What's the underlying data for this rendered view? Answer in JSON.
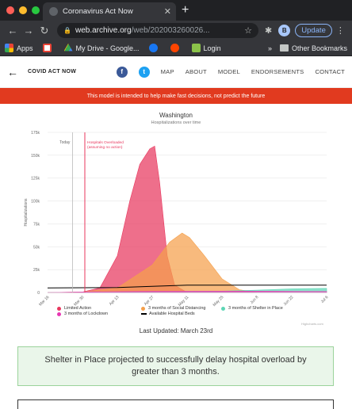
{
  "browser": {
    "tab_title": "Coronavirus Act Now",
    "url_host": "web.archive.org",
    "url_path": "/web/202003260026...",
    "update_label": "Update",
    "profile_initial": "B",
    "bookmarks": [
      {
        "label": "Apps",
        "icon": "apps-icon",
        "color": "#ea4335"
      },
      {
        "label": "",
        "icon": "gmail-icon",
        "color": "#ea4335"
      },
      {
        "label": "My Drive - Google...",
        "icon": "drive-icon",
        "color": "#34a853"
      },
      {
        "label": "",
        "icon": "facebook-icon",
        "color": "#1877f2"
      },
      {
        "label": "",
        "icon": "reddit-icon",
        "color": "#ff4500"
      },
      {
        "label": "Login",
        "icon": "login-icon",
        "color": "#8bc34a"
      }
    ],
    "other_bookmarks": "Other Bookmarks"
  },
  "site": {
    "brand": "COVID ACT NOW",
    "nav": [
      "MAP",
      "ABOUT",
      "MODEL",
      "ENDORSEMENTS",
      "CONTACT"
    ],
    "banner": "This model is intended to help make fast decisions, not predict the future",
    "last_updated": "Last Updated: March 23rd",
    "callout": "Shelter in Place projected to successfully delay hospital overload by greater than 3 months.",
    "credit": "Highcharts.com"
  },
  "chart_data": {
    "type": "area",
    "title": "Washington",
    "subtitle": "Hospitalizations over time",
    "ylabel": "Hospitalizations",
    "ylim": [
      0,
      175000
    ],
    "yticks": [
      "0",
      "25k",
      "50k",
      "75k",
      "100k",
      "125k",
      "150k",
      "175k"
    ],
    "xticks": [
      "Mar 16",
      "Mar 30",
      "Apr 13",
      "Apr 27",
      "May 11",
      "May 25",
      "Jun 8",
      "Jun 22",
      "Jul 6"
    ],
    "annotations": {
      "today": "Today",
      "overload": "Hospitals Overloaded\n(assuming no action)"
    },
    "series": [
      {
        "name": "Limited Action",
        "color": "#e8375e",
        "points": [
          [
            "Mar 16",
            0
          ],
          [
            "Mar 30",
            500
          ],
          [
            "Apr 6",
            5000
          ],
          [
            "Apr 13",
            40000
          ],
          [
            "Apr 18",
            100000
          ],
          [
            "Apr 22",
            140000
          ],
          [
            "Apr 26",
            157000
          ],
          [
            "Apr 28",
            160000
          ],
          [
            "Apr 30",
            120000
          ],
          [
            "May 3",
            40000
          ],
          [
            "May 6",
            8000
          ],
          [
            "May 11",
            0
          ]
        ]
      },
      {
        "name": "3 months of Lockdown",
        "color": "#e836b4",
        "points": [
          [
            "Mar 16",
            0
          ],
          [
            "Mar 30",
            600
          ],
          [
            "Apr 27",
            1200
          ],
          [
            "Jun 8",
            1500
          ],
          [
            "Jul 6",
            1000
          ]
        ]
      },
      {
        "name": "3 months of Social Distancing",
        "color": "#f5a04b",
        "points": [
          [
            "Mar 16",
            0
          ],
          [
            "Mar 30",
            400
          ],
          [
            "Apr 13",
            5000
          ],
          [
            "Apr 27",
            30000
          ],
          [
            "May 4",
            55000
          ],
          [
            "May 9",
            65000
          ],
          [
            "May 12",
            60000
          ],
          [
            "May 18",
            40000
          ],
          [
            "May 25",
            15000
          ],
          [
            "Jun 1",
            3000
          ],
          [
            "Jun 8",
            0
          ]
        ]
      },
      {
        "name": "3 months of Shelter in Place",
        "color": "#5ed6b5",
        "points": [
          [
            "Mar 16",
            0
          ],
          [
            "Apr 13",
            500
          ],
          [
            "May 25",
            1500
          ],
          [
            "Jun 8",
            2500
          ],
          [
            "Jun 22",
            4000
          ],
          [
            "Jul 6",
            4500
          ]
        ]
      },
      {
        "name": "Available Hospital Beds",
        "color": "#000000",
        "points": [
          [
            "Mar 16",
            5000
          ],
          [
            "Apr 13",
            5500
          ],
          [
            "May 11",
            8000
          ],
          [
            "Jun 8",
            8000
          ],
          [
            "Jul 6",
            8000
          ]
        ]
      }
    ],
    "legend_position": "bottom"
  }
}
